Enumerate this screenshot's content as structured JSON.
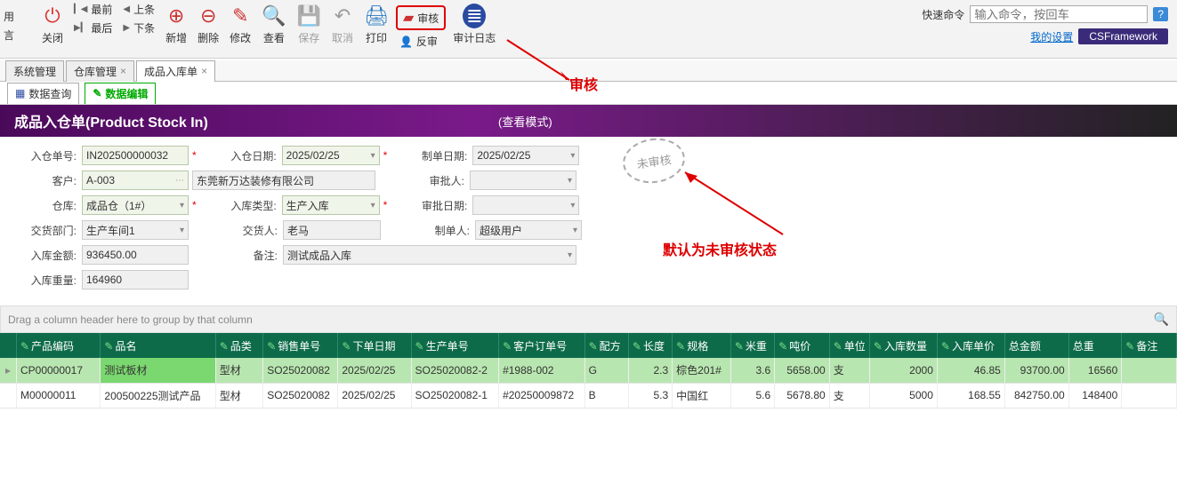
{
  "toolbar": {
    "left_top": "用",
    "left_bot": "言",
    "close": "关闭",
    "first": "最前",
    "last": "最后",
    "prev": "上条",
    "next": "下条",
    "add": "新增",
    "del": "删除",
    "edit": "修改",
    "view": "查看",
    "save": "保存",
    "cancel": "取消",
    "print": "打印",
    "audit": "审核",
    "unaudit": "反审",
    "auditlog": "审计日志"
  },
  "rightbar": {
    "quick_label": "快速命令",
    "quick_placeholder": "输入命令，按回车",
    "settings": "我的设置",
    "brand": "CSFramework"
  },
  "maintabs": {
    "t1": "系统管理",
    "t2": "仓库管理",
    "t3": "成品入库单"
  },
  "subtabs": {
    "query": "数据查询",
    "edit": "数据编辑"
  },
  "band": {
    "title": "成品入仓单(Product Stock In)",
    "mode": "(查看模式)"
  },
  "annot": {
    "audit": "审核",
    "state": "默认为未审核状态",
    "stamp": "未审核"
  },
  "form": {
    "docno_l": "入仓单号:",
    "docno": "IN202500000032",
    "docdate_l": "入仓日期:",
    "docdate": "2025/02/25",
    "createdate_l": "制单日期:",
    "createdate": "2025/02/25",
    "cust_l": "客户:",
    "cust": "A-003",
    "custname": "东莞新万达装修有限公司",
    "approver_l": "审批人:",
    "approver": "",
    "wh_l": "仓库:",
    "wh": "成品仓（1#）",
    "intype_l": "入库类型:",
    "intype": "生产入库",
    "appdate_l": "审批日期:",
    "appdate": "",
    "dept_l": "交货部门:",
    "dept": "生产车间1",
    "hander_l": "交货人:",
    "hander": "老马",
    "creator_l": "制单人:",
    "creator": "超级用户",
    "amt_l": "入库金额:",
    "amt": "936450.00",
    "remark_l": "备注:",
    "remark": "测试成品入库",
    "wgt_l": "入库重量:",
    "wgt": "164960"
  },
  "grid": {
    "grouphint": "Drag a column header here to group by that column",
    "h": {
      "code": "产品编码",
      "name": "品名",
      "cat": "品类",
      "sono": "销售单号",
      "odate": "下单日期",
      "mono": "生产单号",
      "custono": "客户订单号",
      "formula": "配方",
      "len": "长度",
      "spec": "规格",
      "mwt": "米重",
      "twt": "吨价",
      "unit": "单位",
      "qty": "入库数量",
      "price": "入库单价",
      "total": "总金额",
      "twgt": "总重",
      "remark": "备注"
    },
    "rows": [
      {
        "code": "CP00000017",
        "name": "测试板材",
        "cat": "型材",
        "sono": "SO25020082",
        "odate": "2025/02/25",
        "mono": "SO25020082-2",
        "custono": "#1988-002",
        "formula": "G",
        "len": "2.3",
        "spec": "棕色201#",
        "mwt": "3.6",
        "twt": "5658.00",
        "unit": "支",
        "qty": "2000",
        "price": "46.85",
        "total": "93700.00",
        "twgt": "16560",
        "remark": ""
      },
      {
        "code": "M00000011",
        "name": "200500225测试产品",
        "cat": "型材",
        "sono": "SO25020082",
        "odate": "2025/02/25",
        "mono": "SO25020082-1",
        "custono": "#20250009872",
        "formula": "B",
        "len": "5.3",
        "spec": "中国红",
        "mwt": "5.6",
        "twt": "5678.80",
        "unit": "支",
        "qty": "5000",
        "price": "168.55",
        "total": "842750.00",
        "twgt": "148400",
        "remark": ""
      }
    ]
  }
}
